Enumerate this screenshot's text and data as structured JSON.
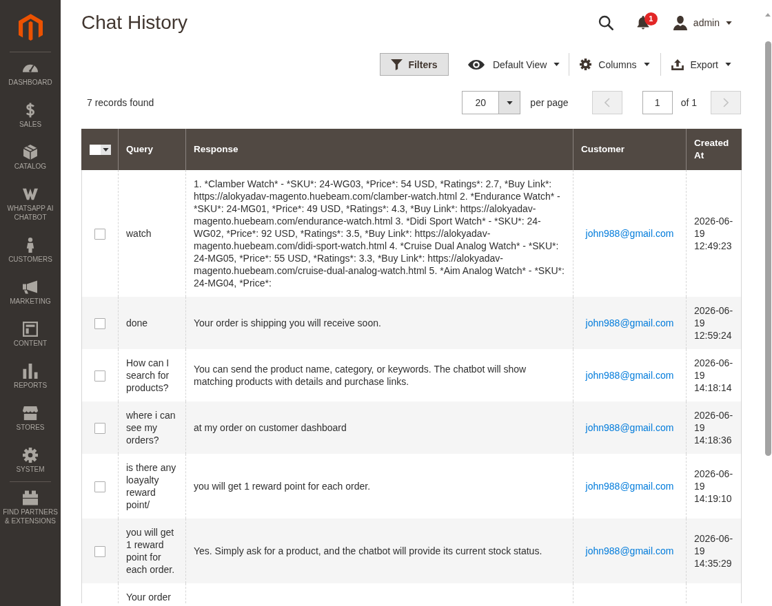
{
  "sidebar": {
    "items": [
      {
        "label": "DASHBOARD"
      },
      {
        "label": "SALES"
      },
      {
        "label": "CATALOG"
      },
      {
        "label": "WHATSAPP AI CHATBOT"
      },
      {
        "label": "CUSTOMERS"
      },
      {
        "label": "MARKETING"
      },
      {
        "label": "CONTENT"
      },
      {
        "label": "REPORTS"
      },
      {
        "label": "STORES"
      },
      {
        "label": "SYSTEM"
      },
      {
        "label": "FIND PARTNERS & EXTENSIONS"
      }
    ]
  },
  "header": {
    "title": "Chat History",
    "notifications": {
      "count": "1"
    },
    "user": {
      "name": "admin"
    }
  },
  "toolbar": {
    "filters": "Filters",
    "view": "Default View",
    "columns": "Columns",
    "export": "Export"
  },
  "grid": {
    "records": "7 records found",
    "per_page": {
      "value": "20",
      "label": "per page"
    },
    "pagination": {
      "prev": {
        "disabled": true
      },
      "page": "1",
      "total": "of 1",
      "next": {
        "disabled": true
      }
    }
  },
  "table": {
    "select_all": {
      "checked": false
    },
    "columns": [
      "Query",
      "Response",
      "Customer",
      "Created At"
    ],
    "rows": [
      {
        "checked": false,
        "query": "watch",
        "response": "1. *Clamber Watch* - *SKU*: 24-WG03, *Price*: 54 USD, *Ratings*: 2.7, *Buy Link*: https://alokyadav-magento.huebeam.com/clamber-watch.html 2. *Endurance Watch* - *SKU*: 24-MG01, *Price*: 49 USD, *Ratings*: 4.3, *Buy Link*: https://alokyadav-magento.huebeam.com/endurance-watch.html 3. *Didi Sport Watch* - *SKU*: 24-WG02, *Price*: 92 USD, *Ratings*: 3.5, *Buy Link*: https://alokyadav-magento.huebeam.com/didi-sport-watch.html 4. *Cruise Dual Analog Watch* - *SKU*: 24-MG05, *Price*: 55 USD, *Ratings*: 3.3, *Buy Link*: https://alokyadav-magento.huebeam.com/cruise-dual-analog-watch.html 5. *Aim Analog Watch* - *SKU*: 24-MG04, *Price*:",
        "customer": "john988@gmail.com",
        "created_at": "2026-06-19 12:49:23"
      },
      {
        "checked": false,
        "query": "done",
        "response": "Your order is shipping you will receive soon.",
        "customer": "john988@gmail.com",
        "created_at": "2026-06-19 12:59:24"
      },
      {
        "checked": false,
        "query": "How can I search for products?",
        "response": "You can send the product name, category, or keywords. The chatbot will show matching products with details and purchase links.",
        "customer": "john988@gmail.com",
        "created_at": "2026-06-19 14:18:14"
      },
      {
        "checked": false,
        "query": "where i can see my orders?",
        "response": "at my order on customer dashboard",
        "customer": "john988@gmail.com",
        "created_at": "2026-06-19 14:18:36"
      },
      {
        "checked": false,
        "query": "is there any loayalty reward point/",
        "response": "you will get 1 reward point for each order.",
        "customer": "john988@gmail.com",
        "created_at": "2026-06-19 14:19:10"
      },
      {
        "checked": false,
        "query": "you will get 1 reward point for each order.",
        "response": "Yes. Simply ask for a product, and the chatbot will provide its current stock status.",
        "customer": "john988@gmail.com",
        "created_at": "2026-06-19 14:35:29"
      },
      {
        "query": "Your order"
      }
    ]
  }
}
